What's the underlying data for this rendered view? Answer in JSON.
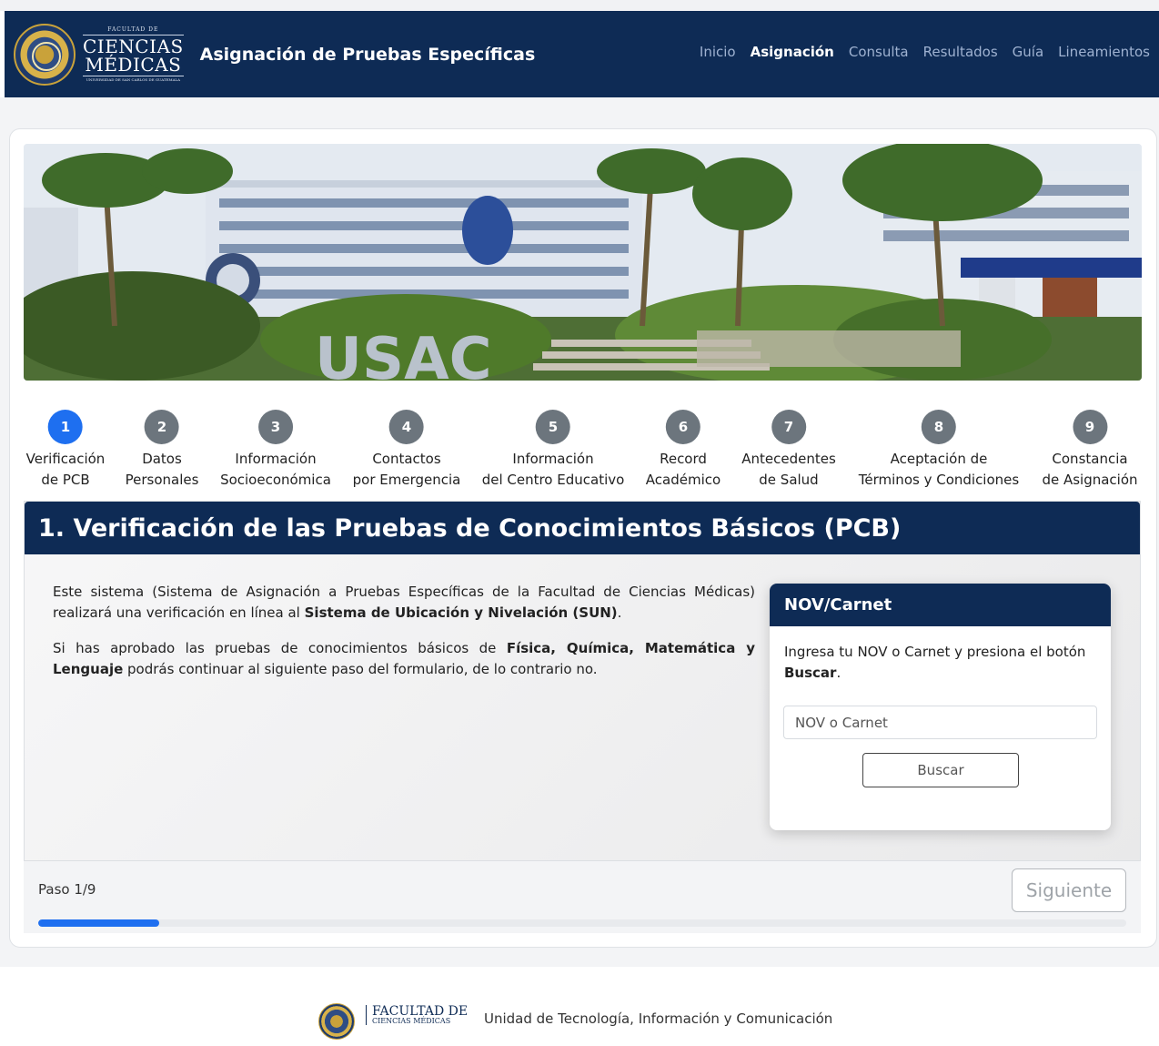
{
  "header": {
    "logo": {
      "line_small": "FACULTAD DE",
      "line1": "CIENCIAS",
      "line2": "MÉDICAS",
      "line_tiny": "UNIVERSIDAD DE SAN CARLOS DE GUATEMALA"
    },
    "app_title": "Asignación de Pruebas Específicas",
    "nav": [
      {
        "label": "Inicio",
        "active": false
      },
      {
        "label": "Asignación",
        "active": true
      },
      {
        "label": "Consulta",
        "active": false
      },
      {
        "label": "Resultados",
        "active": false
      },
      {
        "label": "Guía",
        "active": false
      },
      {
        "label": "Lineamientos",
        "active": false
      }
    ]
  },
  "steps": [
    {
      "num": "1",
      "line1": "Verificación",
      "line2": "de PCB",
      "active": true
    },
    {
      "num": "2",
      "line1": "Datos",
      "line2": "Personales",
      "active": false
    },
    {
      "num": "3",
      "line1": "Información",
      "line2": "Socioeconómica",
      "active": false
    },
    {
      "num": "4",
      "line1": "Contactos",
      "line2": "por Emergencia",
      "active": false
    },
    {
      "num": "5",
      "line1": "Información",
      "line2": "del Centro Educativo",
      "active": false
    },
    {
      "num": "6",
      "line1": "Record",
      "line2": "Académico",
      "active": false
    },
    {
      "num": "7",
      "line1": "Antecedentes",
      "line2": "de Salud",
      "active": false
    },
    {
      "num": "8",
      "line1": "Aceptación de",
      "line2": "Términos y Condiciones",
      "active": false
    },
    {
      "num": "9",
      "line1": "Constancia",
      "line2": "de Asignación",
      "active": false
    }
  ],
  "section": {
    "title": "1. Verificación de las Pruebas de Conocimientos Básicos (PCB)",
    "p1_part1": "Este sistema (Sistema de Asignación a Pruebas Específicas de la Facultad de Ciencias Médicas) realizará una verificación en línea al ",
    "p1_bold": "Sistema de Ubicación y Nivelación (SUN)",
    "p1_end": ".",
    "p2_part1": "Si has aprobado las pruebas de conocimientos básicos de ",
    "p2_bold": "Física, Química, Matemática y Lenguaje",
    "p2_end": " podrás continuar al siguiente paso del formulario, de lo contrario no."
  },
  "nov": {
    "title": "NOV/Carnet",
    "instr_part1": "Ingresa tu NOV o Carnet y presiona el botón ",
    "instr_bold": "Buscar",
    "instr_end": ".",
    "placeholder": "NOV o Carnet",
    "button": "Buscar"
  },
  "footer_bar": {
    "paso": "Paso 1/9",
    "next": "Siguiente",
    "progress_fraction": 0.111
  },
  "page_footer": {
    "brand_line1": "FACULTAD DE",
    "brand_line2": "CIENCIAS MÉDICAS",
    "unit": "Unidad de Tecnología, Información y Comunicación"
  },
  "colors": {
    "navy": "#0e2b55",
    "accent": "#1e6ff0",
    "step_inactive": "#6c757d"
  }
}
